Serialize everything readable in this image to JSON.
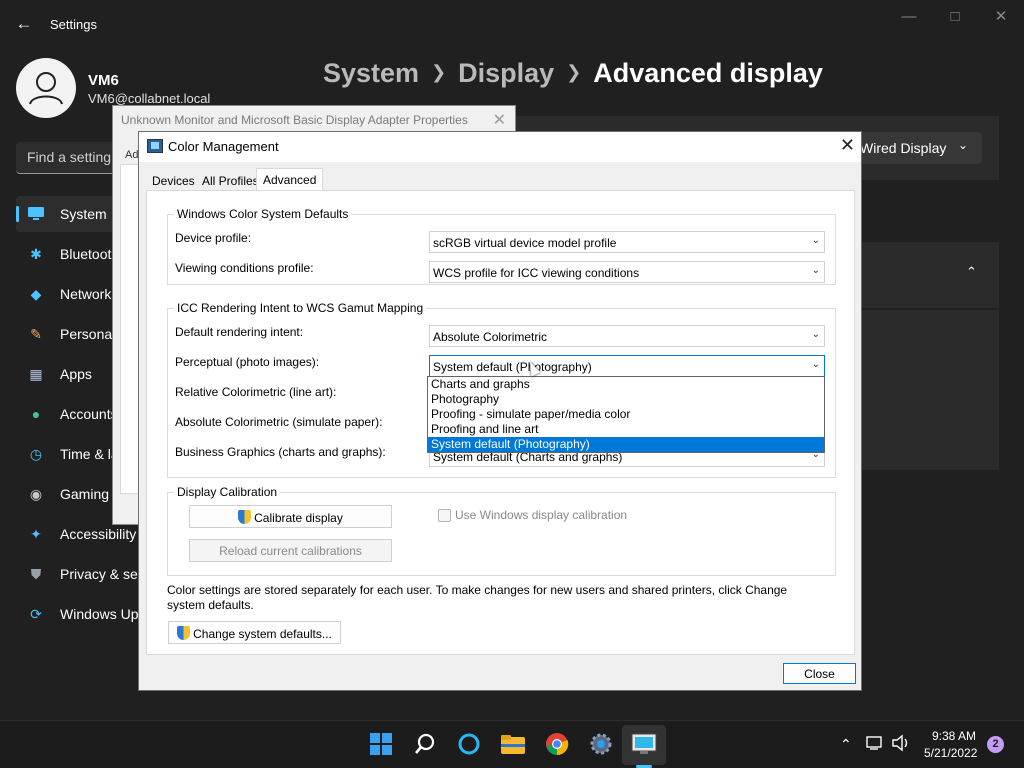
{
  "settings": {
    "app_title": "Settings",
    "user": {
      "name": "VM6",
      "email": "VM6@collabnet.local"
    },
    "breadcrumb": [
      "System",
      "Display",
      "Advanced display"
    ],
    "search_placeholder": "Find a setting",
    "nav": [
      {
        "label": "System",
        "icon": "monitor-icon",
        "active": true
      },
      {
        "label": "Bluetooth & devices",
        "icon": "bluetooth-icon"
      },
      {
        "label": "Network & internet",
        "icon": "wifi-icon"
      },
      {
        "label": "Personalization",
        "icon": "brush-icon"
      },
      {
        "label": "Apps",
        "icon": "apps-icon"
      },
      {
        "label": "Accounts",
        "icon": "person-icon"
      },
      {
        "label": "Time & language",
        "icon": "clock-icon"
      },
      {
        "label": "Gaming",
        "icon": "gamepad-icon"
      },
      {
        "label": "Accessibility",
        "icon": "accessibility-icon"
      },
      {
        "label": "Privacy & security",
        "icon": "shield-icon"
      },
      {
        "label": "Windows Update",
        "icon": "update-icon"
      }
    ],
    "display_selector": "Wired Display",
    "accent_color": "#4cc2ff"
  },
  "properties_dialog": {
    "title": "Unknown Monitor and Microsoft Basic Display Adapter Properties",
    "tab_partial": "Ad"
  },
  "color_management": {
    "title": "Color Management",
    "tabs": [
      "Devices",
      "All Profiles",
      "Advanced"
    ],
    "active_tab": "Advanced",
    "wcs_group": {
      "legend": "Windows Color System Defaults",
      "device_profile_label": "Device profile:",
      "device_profile_value": "scRGB virtual device model profile",
      "viewing_label": "Viewing conditions profile:",
      "viewing_value": "WCS profile for ICC viewing conditions"
    },
    "icc_group": {
      "legend": "ICC Rendering Intent to WCS Gamut Mapping",
      "default_label": "Default rendering intent:",
      "default_value": "Absolute Colorimetric",
      "perceptual_label": "Perceptual (photo images):",
      "perceptual_value": "System default (Photography)",
      "relative_label": "Relative Colorimetric (line art):",
      "absolute_label": "Absolute Colorimetric (simulate paper):",
      "business_label": "Business Graphics (charts and graphs):",
      "business_value": "System default (Charts and graphs)",
      "dropdown_options": [
        "Charts and graphs",
        "Photography",
        "Proofing - simulate paper/media color",
        "Proofing and line art",
        "System default (Photography)"
      ],
      "dropdown_selected_index": 4
    },
    "calibration_group": {
      "legend": "Display Calibration",
      "calibrate_button": "Calibrate display",
      "reload_button": "Reload current calibrations",
      "use_windows_calibration": "Use Windows display calibration"
    },
    "footer_text": "Color settings are stored separately for each user. To make changes for new users and shared printers, click Change system defaults.",
    "change_defaults_button": "Change system defaults...",
    "close_button": "Close"
  },
  "taskbar": {
    "time": "9:38 AM",
    "date": "5/21/2022",
    "notification_count": "2"
  }
}
